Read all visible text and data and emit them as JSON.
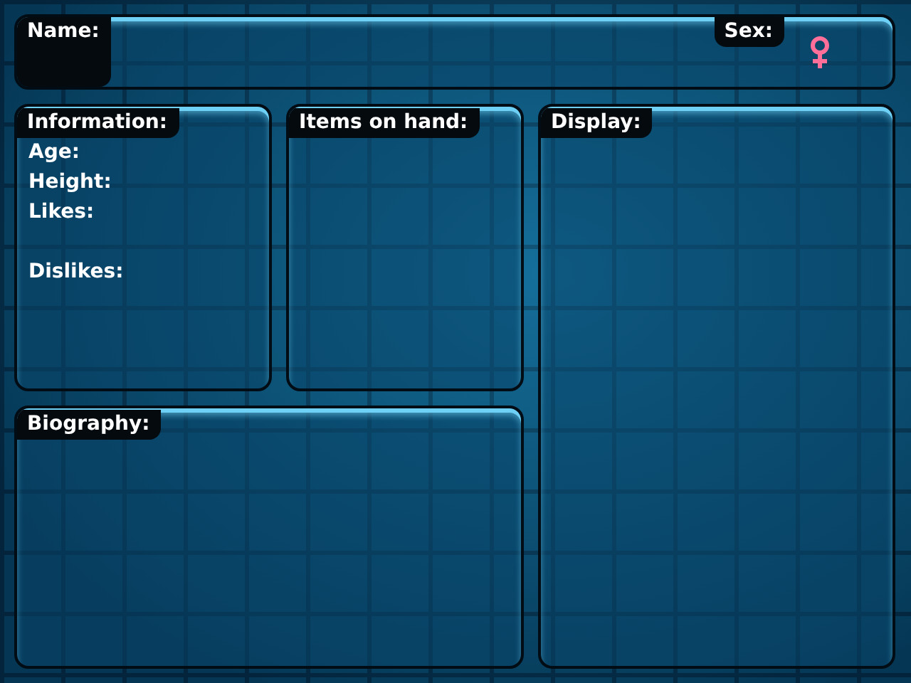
{
  "name_bar": {
    "label": "Name:",
    "sex_label": "Sex:",
    "sex": {
      "kind": "female"
    }
  },
  "information": {
    "title": "Information:",
    "fields": [
      {
        "label": "Age:"
      },
      {
        "label": "Height:"
      },
      {
        "label": "Likes:"
      },
      {
        "label": "Dislikes:"
      }
    ]
  },
  "items_on_hand": {
    "title": "Items on hand:"
  },
  "display": {
    "title": "Display:"
  },
  "biography": {
    "title": "Biography:"
  }
}
